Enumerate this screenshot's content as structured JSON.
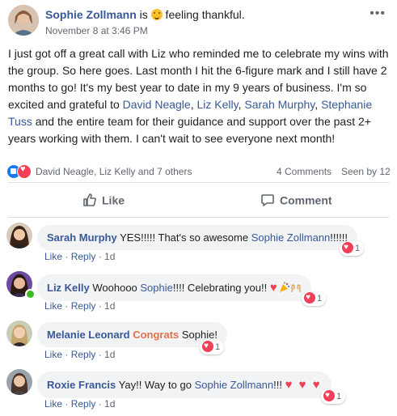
{
  "post": {
    "author": "Sophie Zollmann",
    "status_prefix": " is ",
    "status_text": " feeling thankful.",
    "timestamp": "November 8 at 3:46 PM",
    "more": "•••",
    "body": {
      "p1": "I just got off a great call with Liz who reminded me to celebrate my wins with the group. So here goes. Last month I hit the 6-figure mark and I still have 2 months to go! It's my best year to date in my 9 years of business. I'm so excited and grateful to ",
      "m1": "David Neagle",
      "s1": ", ",
      "m2": "Liz Kelly",
      "s2": ", ",
      "m3": "Sarah Murphy",
      "s3": ", ",
      "m4": "Stephanie Tuss",
      "p2": " and the entire team for their guidance and support over the past 2+ years working with them. I can't wait to see everyone next month!"
    }
  },
  "reactions": {
    "names": "David Neagle, Liz Kelly and 7 others",
    "comments_count": "4 Comments",
    "seen_by": "Seen by 12"
  },
  "actions": {
    "like": "Like",
    "comment": "Comment"
  },
  "comment_actions": {
    "like": "Like",
    "reply": "Reply",
    "sep": " · "
  },
  "comments": [
    {
      "author": "Sarah Murphy",
      "text": " YES!!!!! That's so awesome ",
      "mention": "Sophie Zollmann",
      "tail": "!!!!!!",
      "age": "1d",
      "reactions": "1"
    },
    {
      "author": "Liz Kelly",
      "text": " Woohooo ",
      "mention": "Sophie",
      "tail": "!!!! Celebrating you!! ",
      "age": "1d",
      "reactions": "1"
    },
    {
      "author": "Melanie Leonard",
      "highlight": "Congrats",
      "tail": " Sophie!",
      "age": "1d",
      "reactions": "1"
    },
    {
      "author": "Roxie Francis",
      "text": " Yay!! Way to go ",
      "mention": "Sophie Zollmann",
      "tail": "!!! ",
      "age": "1d",
      "reactions": "1"
    }
  ],
  "colors": {
    "link": "#385898",
    "love": "#f33e58",
    "like": "#1877f2",
    "highlight": "#e4704b"
  }
}
